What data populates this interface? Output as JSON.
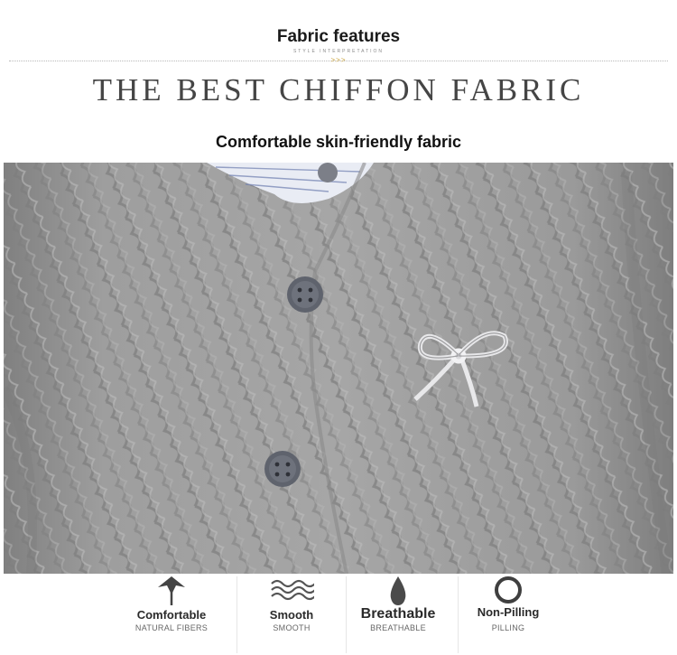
{
  "header": {
    "section_title": "Fabric features",
    "section_subtitle": "STYLE INTERPRETATION",
    "arrows": ">>>",
    "big_title": "THE BEST CHIFFON FABRIC",
    "subtitle": "Comfortable skin-friendly fabric"
  },
  "photo": {
    "subject": "grey cable-knit cardigan with buttons and bow brooch",
    "icons": [
      "button-icon",
      "bow-brooch-icon"
    ]
  },
  "features": [
    {
      "name": "Comfortable",
      "desc": "NATURAL FIBERS",
      "icon": "leaf-icon"
    },
    {
      "name": "Smooth",
      "desc": "SMOOTH",
      "icon": "waves-icon"
    },
    {
      "name": "Breathable",
      "desc": "BREATHABLE",
      "icon": "drop-icon"
    },
    {
      "name": "Non-Pilling",
      "desc": "PILLING",
      "icon": "ring-icon"
    }
  ],
  "colors": {
    "title_text": "#1a1a1a",
    "big_title_text": "#454545",
    "fabric_grey": "#9c9c9c",
    "icon_dark": "#4a4a4a",
    "arrow_accent": "#c9a23a"
  }
}
